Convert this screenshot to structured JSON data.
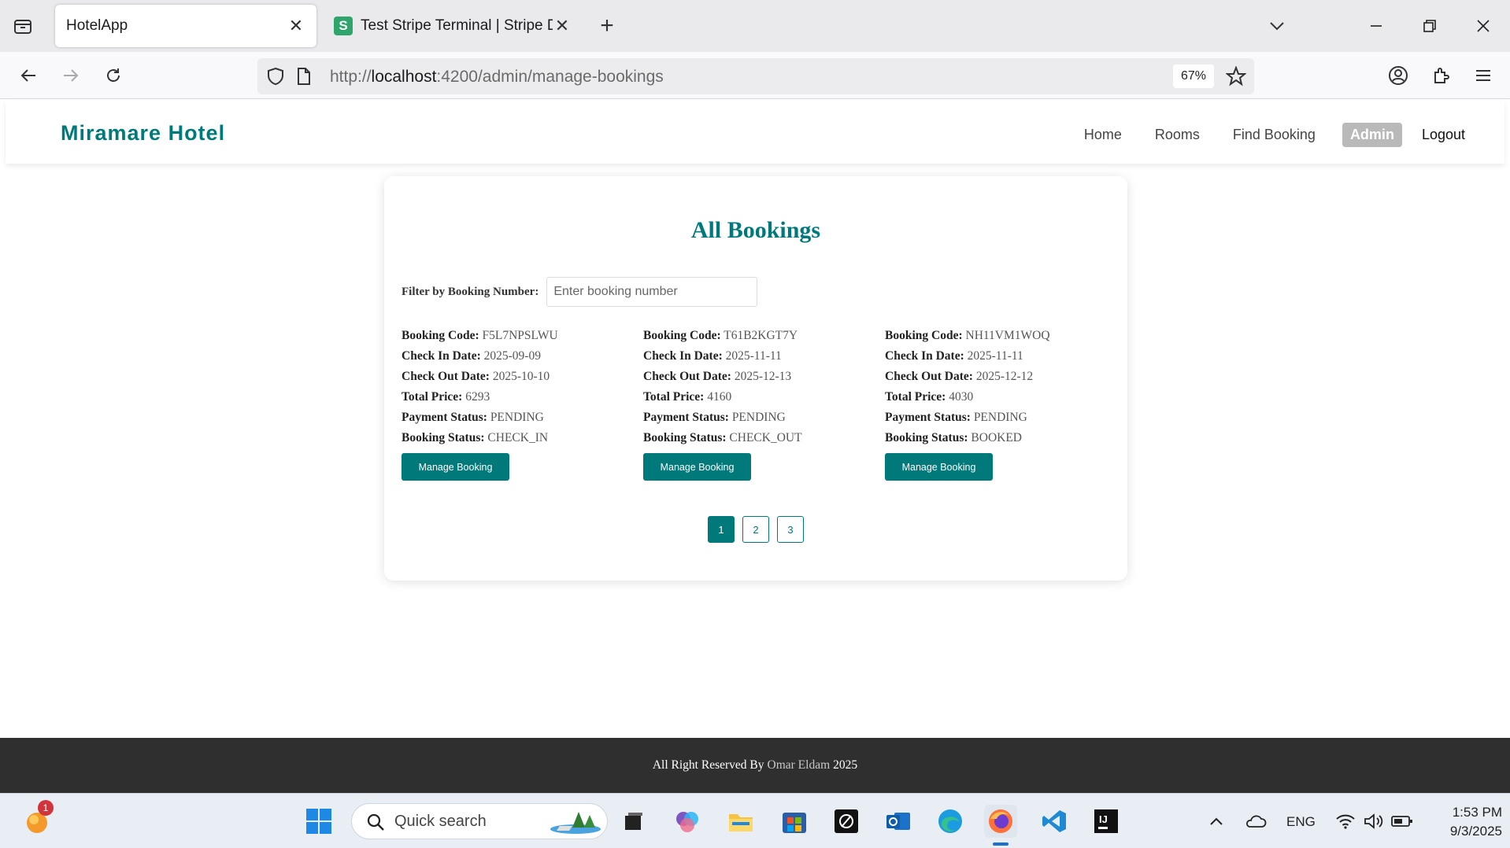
{
  "browser": {
    "tabs": [
      {
        "title": "HotelApp",
        "active": true
      },
      {
        "title": "Test Stripe Terminal | Stripe Doc",
        "active": false,
        "favicon_letter": "S"
      }
    ],
    "url_prefix": "http://",
    "url_host": "localhost",
    "url_rest": ":4200/admin/manage-bookings",
    "zoom": "67%"
  },
  "app": {
    "brand": "Miramare Hotel",
    "nav": {
      "home": "Home",
      "rooms": "Rooms",
      "find_booking": "Find Booking",
      "admin": "Admin",
      "logout": "Logout"
    },
    "page_title": "All Bookings",
    "filter": {
      "label": "Filter by Booking Number:",
      "placeholder": "Enter booking number"
    },
    "labels": {
      "code": "Booking Code:",
      "check_in": "Check In Date:",
      "check_out": "Check Out Date:",
      "price": "Total Price:",
      "payment": "Payment Status:",
      "status": "Booking Status:"
    },
    "bookings": [
      {
        "code": "F5L7NPSLWU",
        "check_in": "2025-09-09",
        "check_out": "2025-10-10",
        "price": "6293",
        "payment": "PENDING",
        "status": "CHECK_IN"
      },
      {
        "code": "T61B2KGT7Y",
        "check_in": "2025-11-11",
        "check_out": "2025-12-13",
        "price": "4160",
        "payment": "PENDING",
        "status": "CHECK_OUT"
      },
      {
        "code": "NH11VM1WOQ",
        "check_in": "2025-11-11",
        "check_out": "2025-12-12",
        "price": "4030",
        "payment": "PENDING",
        "status": "BOOKED"
      }
    ],
    "manage_label": "Manage Booking",
    "pages": [
      "1",
      "2",
      "3"
    ],
    "footer": {
      "prefix": "All Right Reserved By",
      "author": "Omar Eldam",
      "year": "2025"
    }
  },
  "taskbar": {
    "search_placeholder": "Quick search",
    "notification_count": "1",
    "language": "ENG",
    "time": "1:53 PM",
    "date": "9/3/2025"
  },
  "colors": {
    "accent": "#00797a",
    "footer_bg": "#2f2f2f",
    "admin_bg": "#b9b9b9"
  }
}
